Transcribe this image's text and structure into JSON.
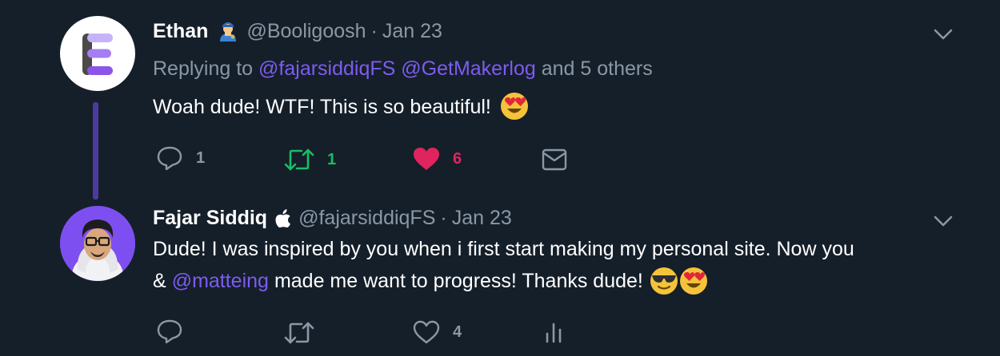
{
  "colors": {
    "background": "#151f2a",
    "secondary_text": "#8a98a6",
    "mention": "#7d5cf0",
    "retweet_active": "#17bf63",
    "like_active": "#e0245e",
    "thread_line": "#4b3aa0"
  },
  "tweets": [
    {
      "name": "Ethan",
      "handle": "@Booligoosh",
      "separator": "·",
      "date": "Jan 23",
      "name_badge_icon": "person-emoji-icon",
      "replying_prefix": "Replying to",
      "replying_mentions": [
        "@fajarsiddiqFS",
        "@GetMakerlog"
      ],
      "replying_suffix": "and 5 others",
      "text": "Woah dude! WTF! This is so beautiful!",
      "text_emojis": [
        "heart-eyes-emoji"
      ],
      "actions": {
        "reply_count": "1",
        "retweet_count": "1",
        "like_count": "6",
        "retweeted": true,
        "liked": true
      }
    },
    {
      "name": "Fajar Siddiq",
      "handle": "@fajarsiddiqFS",
      "separator": "·",
      "date": "Jan 23",
      "name_badge_icon": "apple-icon",
      "text_line1": "Dude! I was inspired by you when i first start making my personal site. Now you",
      "text_line2_prefix": "&",
      "text_line2_mention": "@matteing",
      "text_line2_suffix": "made me want to progress! Thanks dude!",
      "text_emojis": [
        "sunglasses-emoji",
        "heart-eyes-emoji"
      ],
      "actions": {
        "reply_count": "",
        "retweet_count": "",
        "like_count": "4",
        "retweeted": false,
        "liked": false
      }
    }
  ]
}
